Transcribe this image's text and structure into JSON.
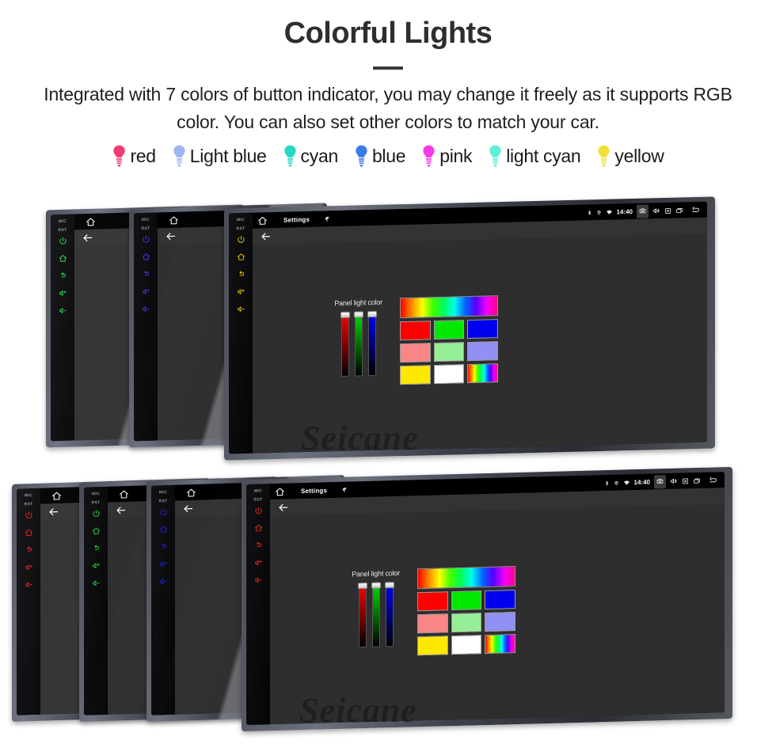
{
  "header": {
    "title": "Colorful Lights",
    "subtitle": "Integrated with 7 colors of button indicator, you may change it freely as it supports RGB color. You can also set other colors to match your car."
  },
  "legend": {
    "items": [
      {
        "label": "red",
        "icon": "bulb-icon",
        "color": "#F23A6E"
      },
      {
        "label": "Light blue",
        "icon": "bulb-icon",
        "color": "#9FB5F2"
      },
      {
        "label": "cyan",
        "icon": "bulb-icon",
        "color": "#25D7C6"
      },
      {
        "label": "blue",
        "icon": "bulb-icon",
        "color": "#3A7DE8"
      },
      {
        "label": "pink",
        "icon": "bulb-icon",
        "color": "#F73AEA"
      },
      {
        "label": "light cyan",
        "icon": "bulb-icon",
        "color": "#5EF0D8"
      },
      {
        "label": "yellow",
        "icon": "bulb-icon",
        "color": "#F2E03A"
      }
    ]
  },
  "device": {
    "keypad": {
      "mic_label": "MIC",
      "rst_label": "RST",
      "keys": [
        {
          "name": "power-icon"
        },
        {
          "name": "home-icon"
        },
        {
          "name": "back-icon"
        },
        {
          "name": "volume-up-icon"
        },
        {
          "name": "volume-down-icon"
        }
      ]
    },
    "statusbar": {
      "home_icon": "home-icon",
      "title": "Settings",
      "usb_icon": "usb-icon",
      "bluetooth_icon": "bluetooth-icon",
      "location_icon": "location-pin-icon",
      "wifi_icon": "wifi-icon",
      "clock": "14:40",
      "camera_icon": "camera-icon",
      "volume_icon": "speaker-icon",
      "close_icon": "close-box-icon",
      "recents_icon": "recent-apps-icon",
      "back_icon": "back-arrow-icon"
    },
    "appbar": {
      "back_icon": "back-arrow-icon"
    },
    "picker": {
      "label": "Panel light color",
      "sliders": [
        {
          "name": "red-slider",
          "color": "#ff0000",
          "value": 100
        },
        {
          "name": "green-slider",
          "color": "#00e000",
          "value": 100
        },
        {
          "name": "blue-slider",
          "color": "#0000ff",
          "value": 100
        }
      ],
      "rainbow_bar": "hue-gradient-bar",
      "swatches": [
        {
          "name": "swatch-red",
          "color": "#ff0000"
        },
        {
          "name": "swatch-green",
          "color": "#00e800"
        },
        {
          "name": "swatch-blue",
          "color": "#0000ee"
        },
        {
          "name": "swatch-light-red",
          "color": "#fa8585"
        },
        {
          "name": "swatch-light-green",
          "color": "#96ef96"
        },
        {
          "name": "swatch-light-blue",
          "color": "#9090f5"
        },
        {
          "name": "swatch-yellow",
          "color": "#ffe800"
        },
        {
          "name": "swatch-white",
          "color": "#ffffff"
        },
        {
          "name": "swatch-rainbow",
          "color": "rainbow"
        }
      ]
    }
  },
  "groups": {
    "top": {
      "units": [
        {
          "name": "unit-green",
          "led_color": "#2ee84a",
          "front": false
        },
        {
          "name": "unit-blue",
          "led_color": "#4040f0",
          "front": false
        },
        {
          "name": "unit-yellow",
          "led_color": "#f0d000",
          "front": true
        }
      ]
    },
    "bottom": {
      "units": [
        {
          "name": "unit-red",
          "led_color": "#ef2020",
          "front": false
        },
        {
          "name": "unit-green",
          "led_color": "#20e040",
          "front": false
        },
        {
          "name": "unit-blue",
          "led_color": "#2020f0",
          "front": false
        },
        {
          "name": "unit-red-front",
          "led_color": "#e82a2a",
          "front": true
        }
      ]
    }
  },
  "watermark": {
    "text": "Seicane"
  }
}
